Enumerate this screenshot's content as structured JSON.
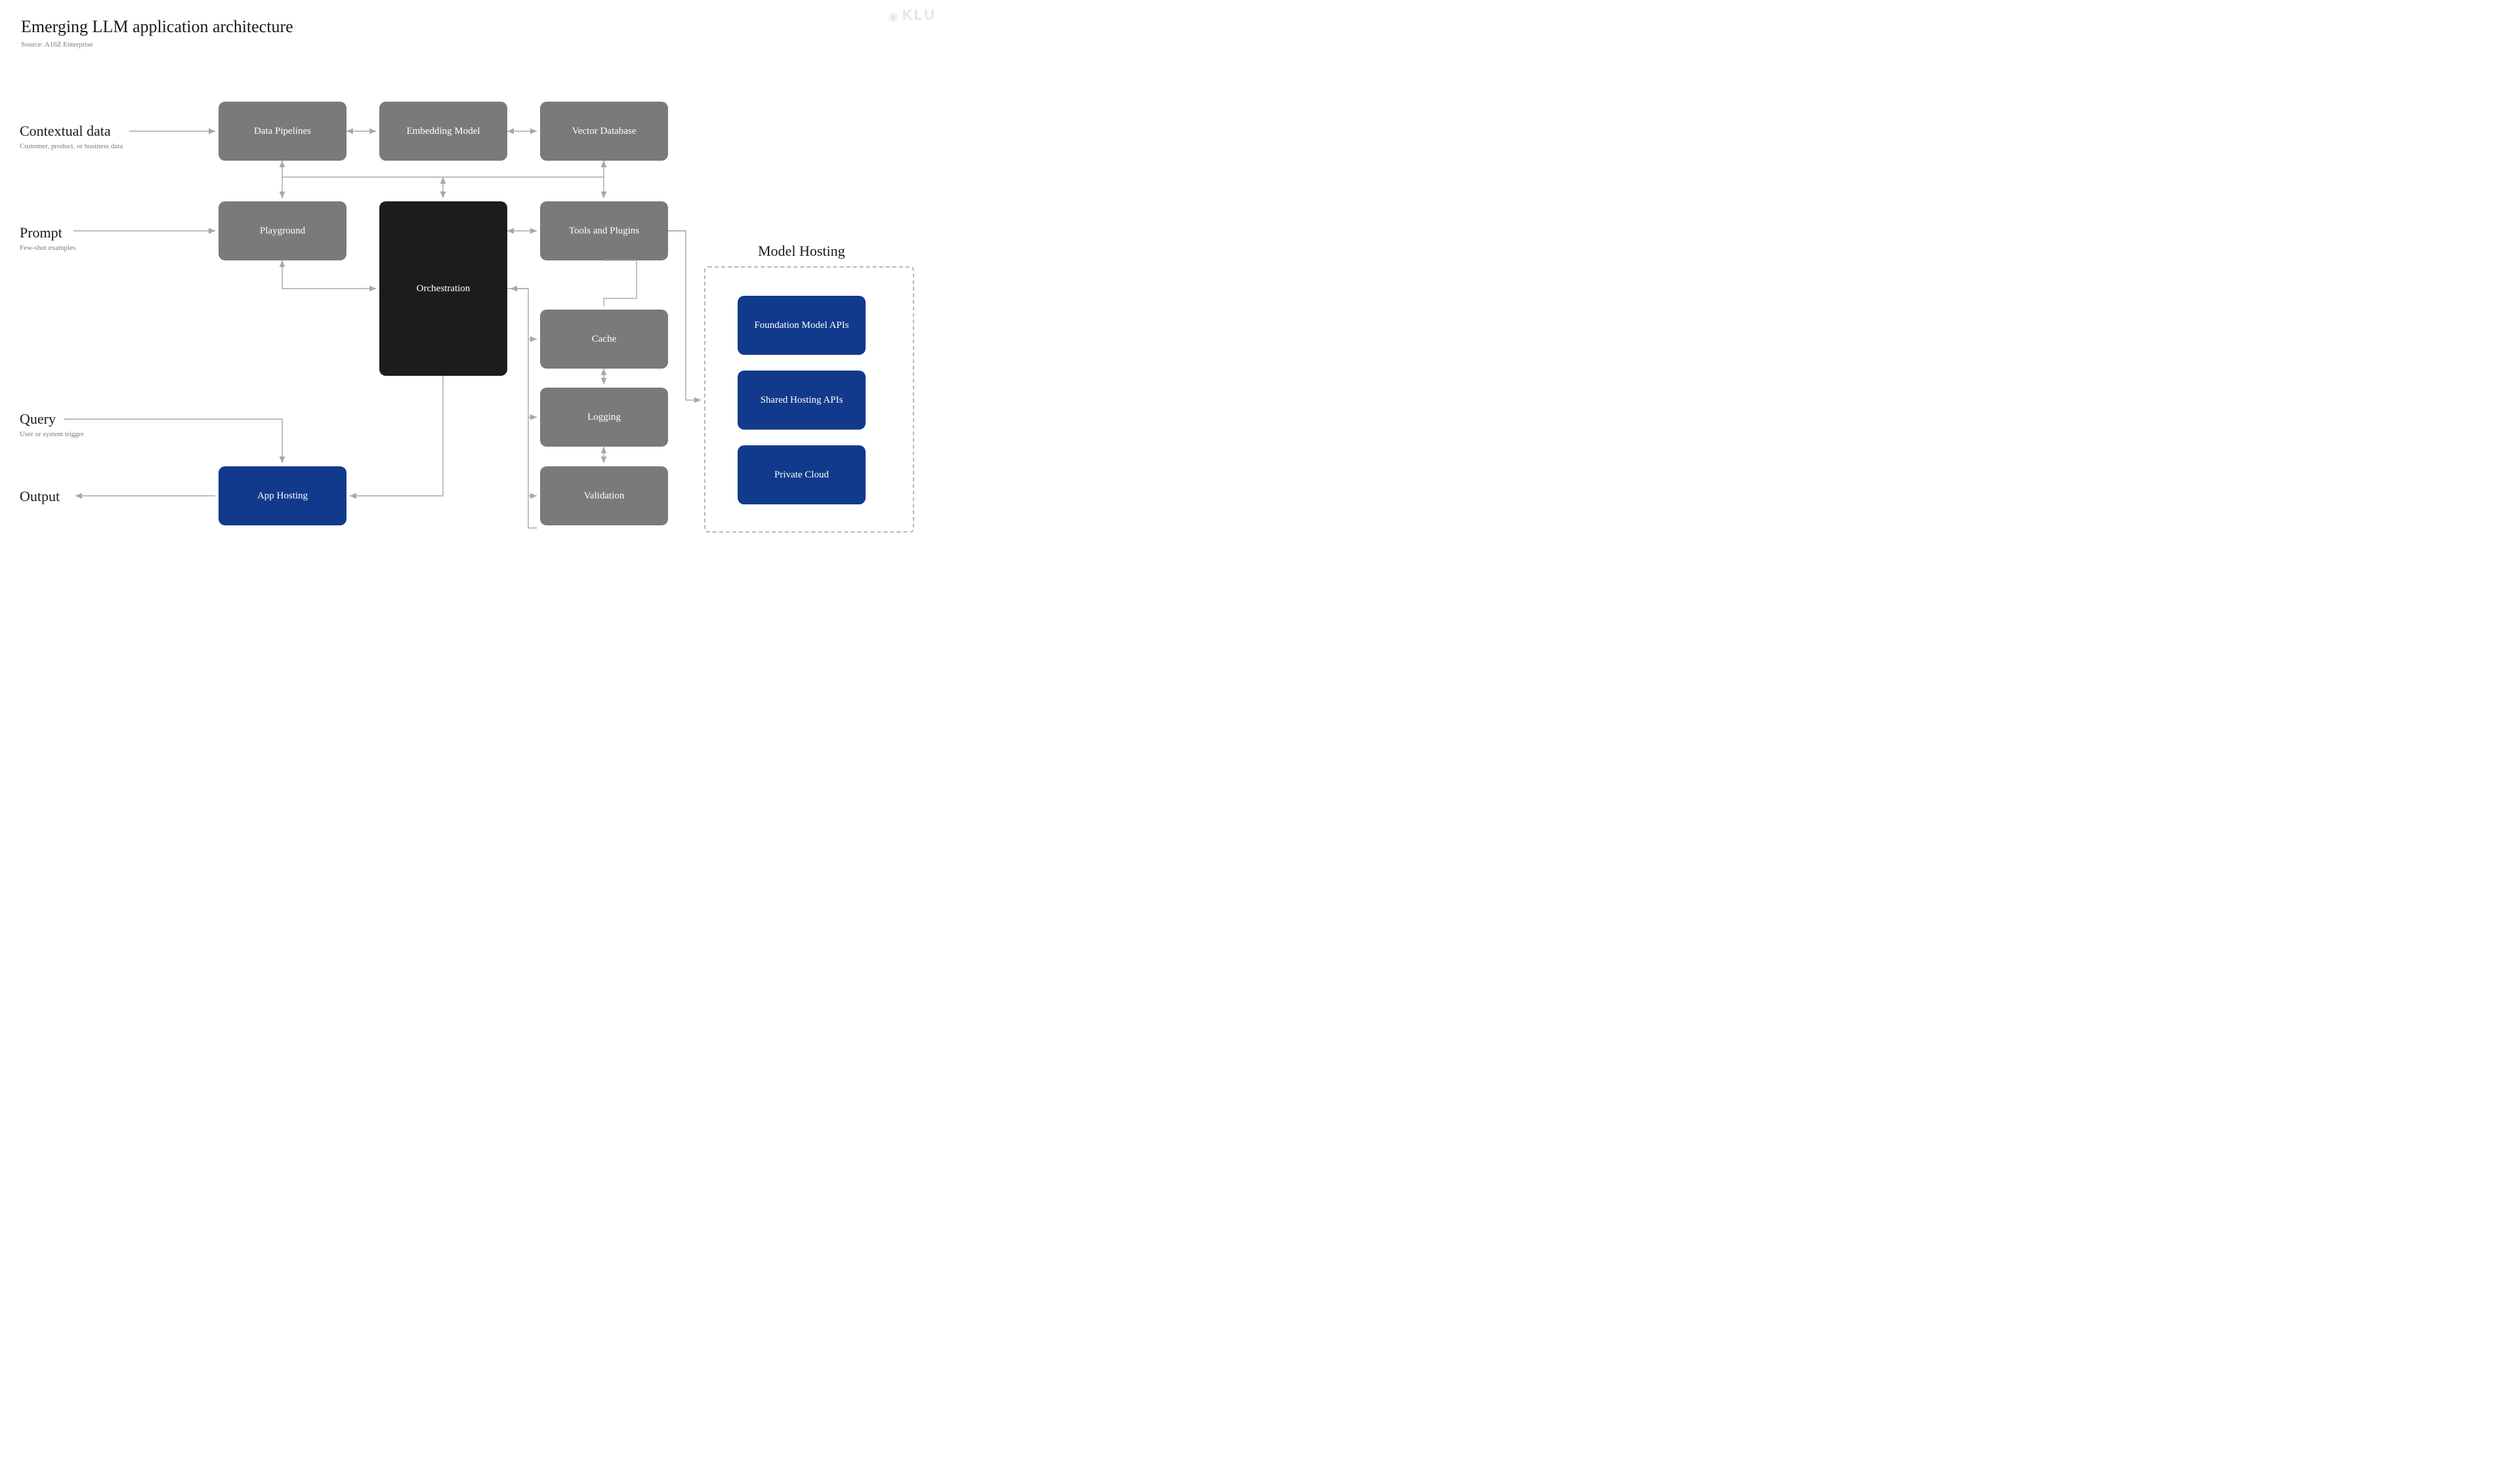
{
  "header": {
    "title": "Emerging LLM application architecture",
    "source": "Source: A16Z Enterprise",
    "brand": "KLU"
  },
  "labels": {
    "contextual": {
      "title": "Contextual data",
      "sub": "Customer, product, or business data"
    },
    "prompt": {
      "title": "Prompt",
      "sub": "Few-shot examples"
    },
    "query": {
      "title": "Query",
      "sub": "User or system trigger"
    },
    "output": {
      "title": "Output",
      "sub": ""
    }
  },
  "group": {
    "model_hosting_title": "Model Hosting"
  },
  "nodes": {
    "data_pipelines": "Data Pipelines",
    "embedding_model": "Embedding Model",
    "vector_database": "Vector Database",
    "playground": "Playground",
    "orchestration": "Orchestration",
    "tools_plugins": "Tools and Plugins",
    "cache": "Cache",
    "logging": "Logging",
    "validation": "Validation",
    "app_hosting": "App Hosting",
    "foundation_api": "Foundation Model APIs",
    "shared_hosting": "Shared Hosting APIs",
    "private_cloud": "Private Cloud"
  },
  "colors": {
    "gray": "#7a7a7a",
    "dark": "#1c1c1c",
    "blue": "#123a8c",
    "arrow": "#a8a8a8",
    "dashed": "#b8b8b8"
  }
}
